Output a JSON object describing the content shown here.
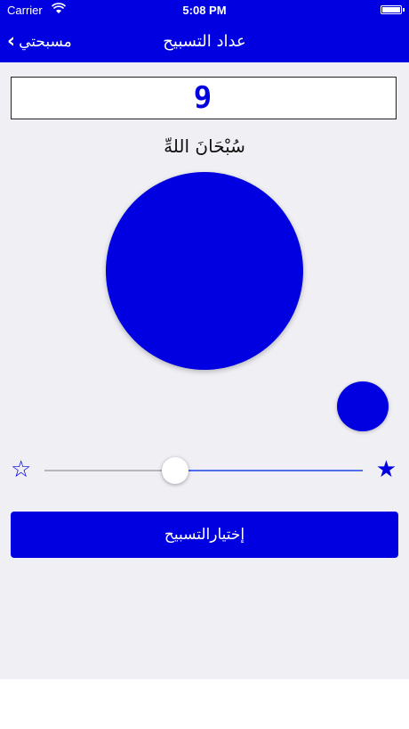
{
  "status_bar": {
    "carrier": "Carrier",
    "time": "5:08 PM"
  },
  "nav": {
    "back_label": "مسبحتي",
    "title": "عداد التسبيح"
  },
  "counter": {
    "value": "9"
  },
  "dhikr": {
    "text": "سُبْحَانَ اللهِّ"
  },
  "slider": {
    "value_fraction": 0.41
  },
  "buttons": {
    "choose_label": "إختيارالتسبيح"
  },
  "colors": {
    "accent": "#0000e0",
    "background": "#efeff4",
    "slider_active": "#4f6ff0",
    "slider_inactive": "#b6b6b6"
  },
  "icons": {
    "back": "chevron-left-icon",
    "wifi": "wifi-icon",
    "battery": "battery-icon",
    "star_empty": "star-outline-icon",
    "star_filled": "star-filled-icon"
  }
}
